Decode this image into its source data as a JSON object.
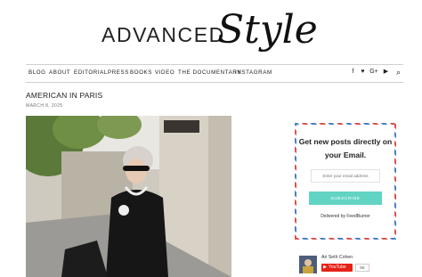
{
  "header": {
    "logo_text": "ADVANCED",
    "logo_script": "Style"
  },
  "nav": {
    "items": [
      "BLOG",
      "ABOUT",
      "EDITORIAL",
      "PRESS",
      "BOOKS",
      "VIDEO",
      "THE DOCUMENTARY",
      "INSTAGRAM"
    ],
    "social": [
      {
        "icon": "facebook-icon",
        "glyph": "f"
      },
      {
        "icon": "twitter-icon",
        "glyph": "♥"
      },
      {
        "icon": "google-plus-icon",
        "glyph": "G+"
      },
      {
        "icon": "youtube-icon",
        "glyph": "▶"
      },
      {
        "icon": "search-icon",
        "glyph": "⌕"
      }
    ]
  },
  "post": {
    "title": "AMERICAN IN PARIS",
    "date": "MARCH 8, 2025"
  },
  "sidebar": {
    "subscribe": {
      "title": "Get new posts directly on your Email.",
      "input_placeholder": "Enter your email address",
      "button_label": "SUBSCRIBE",
      "footer": "Delivered by FeedBurner"
    },
    "youtube": {
      "channel_name": "Ari Seth Cohen",
      "button_label": "YouTube",
      "count": "5K"
    }
  },
  "colors": {
    "accent": "#62d4c4",
    "youtube_red": "#e62117",
    "border_red": "#d9534f",
    "border_blue": "#4a7fc1"
  }
}
